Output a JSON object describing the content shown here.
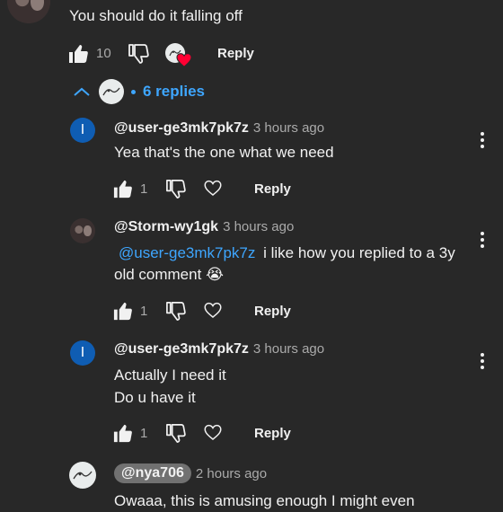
{
  "top_comment": {
    "text": "You should do it falling off",
    "like_count": "10",
    "reply_label": "Reply",
    "replies_toggle": "6 replies"
  },
  "replies": [
    {
      "avatar": "I",
      "handle": "@user-ge3mk7pk7z",
      "time": "3 hours ago",
      "lines": [
        "Yea that's the one what we need"
      ],
      "like_count": "1",
      "reply_label": "Reply"
    },
    {
      "handle": "@Storm-wy1gk",
      "time": "3 hours ago",
      "mention": "@user-ge3mk7pk7z",
      "text_after_mention": "i like how you replied to a 3y",
      "line2": "old comment",
      "emoji": "😭",
      "like_count": "1",
      "reply_label": "Reply"
    },
    {
      "avatar": "I",
      "handle": "@user-ge3mk7pk7z",
      "time": "3 hours ago",
      "lines": [
        "Actually I need it",
        "Do u have it"
      ],
      "like_count": "1",
      "reply_label": "Reply"
    },
    {
      "handle": "@nya706",
      "time": "2 hours ago",
      "lines": [
        "Owaaa, this is amusing enough I might even"
      ]
    }
  ],
  "icons": {
    "like": "thumbs-up-icon",
    "dislike": "thumbs-down-icon",
    "heart": "heart-icon",
    "chevron": "chevron-up-icon",
    "more": "more-vert-icon"
  },
  "colors": {
    "background": "#282828",
    "link": "#3ea6ff",
    "avatar_blue": "#0f5db3",
    "heart": "#ff0033"
  }
}
